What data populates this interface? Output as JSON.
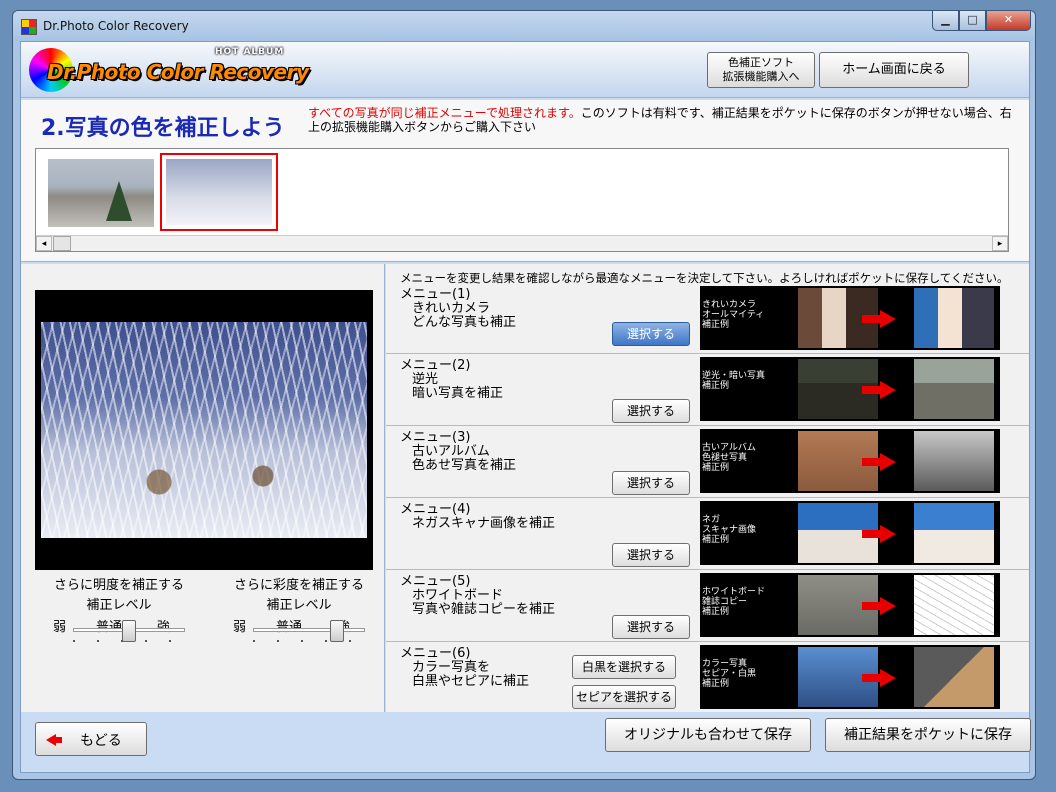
{
  "window": {
    "title": "Dr.Photo Color Recovery",
    "controls": {
      "minimize": "▁",
      "maximize": "□",
      "close": "✕"
    }
  },
  "header": {
    "logo_small": "HOT ALBUM",
    "logo_text": "Dr.Photo Color Recovery",
    "buy_line1": "色補正ソフト",
    "buy_line2": "拡張機能購入へ",
    "home_label": "ホーム画面に戻る"
  },
  "top": {
    "step_title": "2.写真の色を補正しよう",
    "notice_red": "すべての写真が同じ補正メニューで処理されます。",
    "notice_rest": "このソフトは有料です、補正結果をポケットに保存のボタンが押せない場合、右上の拡張機能購入ボタンからご購入下さい",
    "scroll_left": "◂",
    "scroll_right": "▸"
  },
  "adjust": {
    "brightness": {
      "title": "さらに明度を補正する",
      "subtitle": "補正レベル",
      "weak": "弱",
      "normal": "普通",
      "strong": "強",
      "level": 0.5
    },
    "saturation": {
      "title": "さらに彩度を補正する",
      "subtitle": "補正レベル",
      "weak": "弱",
      "normal": "普通",
      "strong": "強",
      "level": 0.75
    }
  },
  "menu": {
    "intro": "メニューを変更し結果を確認しながら最適なメニューを決定して下さい。よろしければポケットに保存してください。",
    "items": [
      {
        "title": "メニュー(1)",
        "line1": "きれいカメラ",
        "line2": "どんな写真も補正",
        "button": "選択する",
        "ex1": "きれいカメラ",
        "ex2": "オールマイティ",
        "ex3": "補正例"
      },
      {
        "title": "メニュー(2)",
        "line1": "逆光",
        "line2": "暗い写真を補正",
        "button": "選択する",
        "ex1": "逆光・暗い写真",
        "ex2": "補正例",
        "ex3": ""
      },
      {
        "title": "メニュー(3)",
        "line1": "古いアルバム",
        "line2": "色あせ写真を補正",
        "button": "選択する",
        "ex1": "古いアルバム",
        "ex2": "色褪せ写真",
        "ex3": "補正例"
      },
      {
        "title": "メニュー(4)",
        "line1": "ネガスキャナ画像を補正",
        "line2": "",
        "button": "選択する",
        "ex1": "ネガ",
        "ex2": "スキャナ画像",
        "ex3": "補正例"
      },
      {
        "title": "メニュー(5)",
        "line1": "ホワイトボード",
        "line2": "写真や雑誌コピーを補正",
        "button": "選択する",
        "ex1": "ホワイトボード",
        "ex2": "雑誌コピー",
        "ex3": "補正例"
      },
      {
        "title": "メニュー(6)",
        "line1": "カラー写真を",
        "line2": "白黒やセピアに補正",
        "button_bw": "白黒を選択する",
        "button_sepia": "セピアを選択する",
        "ex1": "カラー写真",
        "ex2": "セピア・白黒",
        "ex3": "補正例"
      }
    ]
  },
  "bottom": {
    "back": "もどる",
    "save_original": "オリジナルも合わせて保存",
    "save_pocket": "補正結果をポケットに保存"
  }
}
